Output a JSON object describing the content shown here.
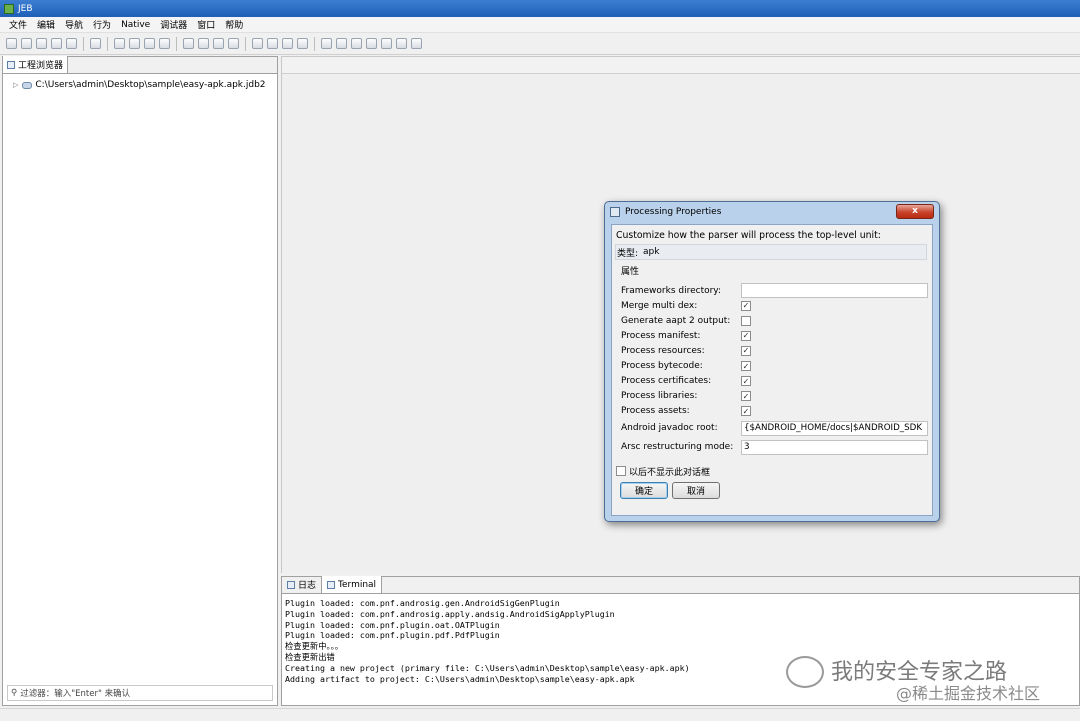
{
  "window": {
    "title": "JEB"
  },
  "menu": {
    "items": [
      "文件",
      "编辑",
      "导航",
      "行为",
      "Native",
      "调试器",
      "窗口",
      "帮助"
    ]
  },
  "left_panel": {
    "tab_label": "工程浏览器",
    "tree_item": "C:\\Users\\admin\\Desktop\\sample\\easy-apk.apk.jdb2",
    "filter_placeholder": "过滤器：输入\"Enter\" 来确认"
  },
  "console": {
    "tabs": [
      "日志",
      "Terminal"
    ],
    "lines": [
      "Plugin loaded: com.pnf.androsig.gen.AndroidSigGenPlugin",
      "Plugin loaded: com.pnf.androsig.apply.andsig.AndroidSigApplyPlugin",
      "Plugin loaded: com.pnf.plugin.oat.OATPlugin",
      "Plugin loaded: com.pnf.plugin.pdf.PdfPlugin",
      "检查更新中。。。",
      "检查更新出错",
      "Creating a new project (primary file: C:\\Users\\admin\\Desktop\\sample\\easy-apk.apk)",
      "Adding artifact to project: C:\\Users\\admin\\Desktop\\sample\\easy-apk.apk"
    ]
  },
  "dialog": {
    "title": "Processing Properties",
    "close_glyph": "x",
    "heading": "Customize how the parser will process the top-level unit:",
    "type_label": "类型:",
    "type_value": "apk",
    "group_label": "属性",
    "properties": {
      "frameworks_dir": {
        "label": "Frameworks directory:",
        "value": ""
      },
      "merge_multi_dex": {
        "label": "Merge multi dex:",
        "checked": true
      },
      "gen_aapt2": {
        "label": "Generate aapt 2 output:",
        "checked": false
      },
      "proc_manifest": {
        "label": "Process manifest:",
        "checked": true
      },
      "proc_resources": {
        "label": "Process resources:",
        "checked": true
      },
      "proc_bytecode": {
        "label": "Process bytecode:",
        "checked": true
      },
      "proc_certificates": {
        "label": "Process certificates:",
        "checked": true
      },
      "proc_libraries": {
        "label": "Process libraries:",
        "checked": true
      },
      "proc_assets": {
        "label": "Process assets:",
        "checked": true
      },
      "javadoc_root": {
        "label": "Android javadoc root:",
        "value": "{$ANDROID_HOME/docs|$ANDROID_SDK"
      },
      "arsc_mode": {
        "label": "Arsc restructuring mode:",
        "value": "3"
      }
    },
    "dont_show_label": "以后不显示此对话框",
    "ok_label": "确定",
    "cancel_label": "取消"
  },
  "watermark": {
    "line1": "我的安全专家之路",
    "line2": "@稀土掘金技术社区"
  },
  "check_glyph": "✓"
}
